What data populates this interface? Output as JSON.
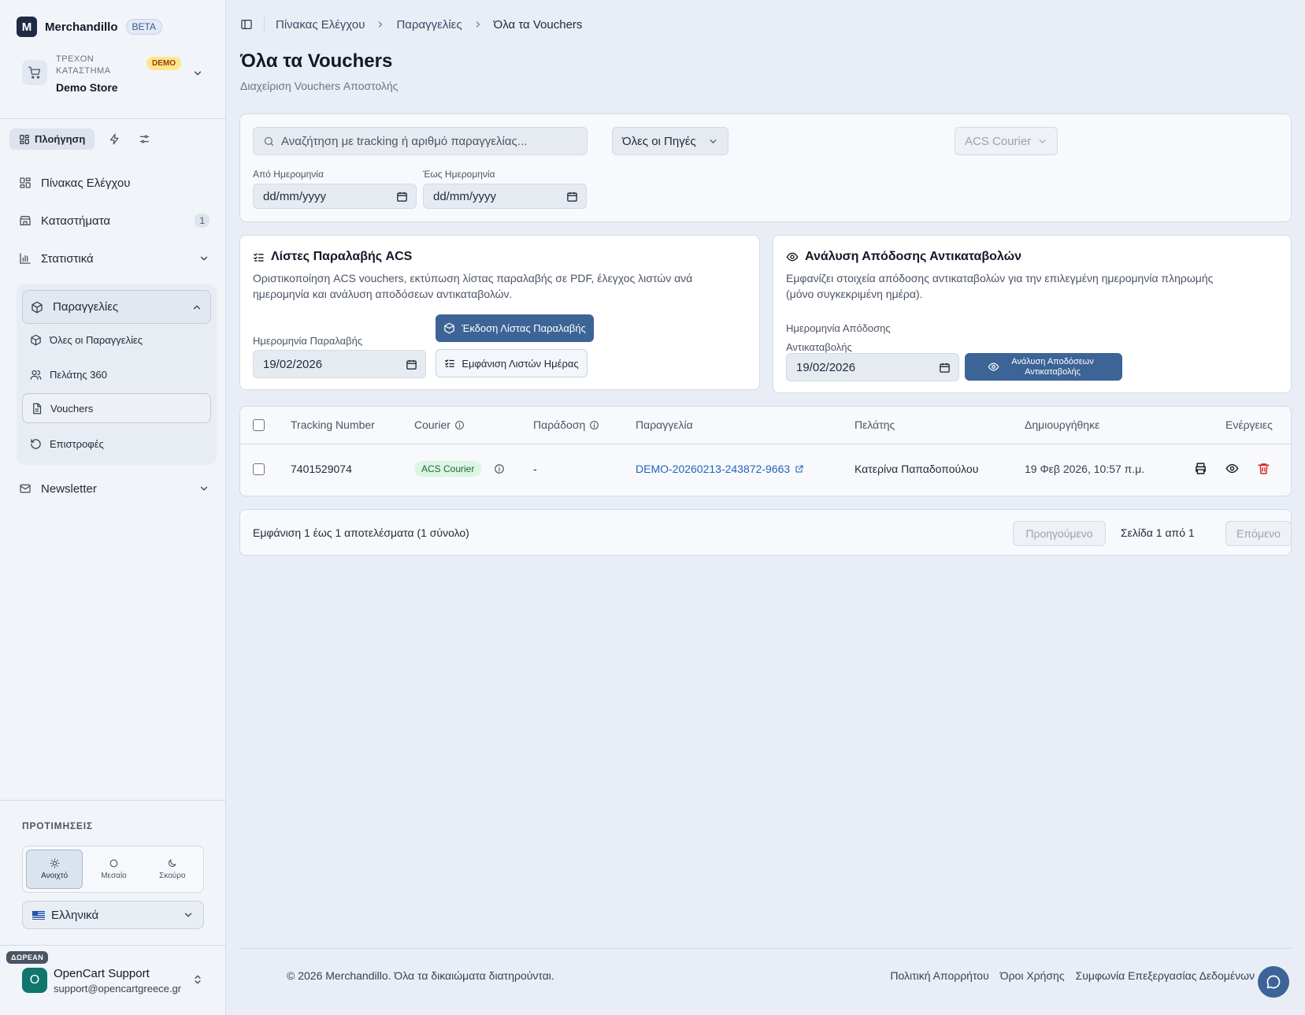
{
  "app": {
    "name": "Merchandillo",
    "badge": "BETA"
  },
  "store": {
    "caption": "ΤΡΕΧΟΝ ΚΑΤΑΣΤΗΜΑ",
    "name": "Demo Store",
    "badge": "DEMO"
  },
  "sidebar": {
    "tab_label": "Πλοήγηση",
    "items": [
      {
        "label": "Πίνακας Ελέγχου"
      },
      {
        "label": "Καταστήματα",
        "count": "1"
      },
      {
        "label": "Στατιστικά"
      }
    ],
    "orders_group": {
      "label": "Παραγγελίες",
      "children": [
        {
          "label": "Όλες οι Παραγγελίες"
        },
        {
          "label": "Πελάτης 360"
        },
        {
          "label": "Vouchers"
        },
        {
          "label": "Επιστροφές"
        }
      ]
    },
    "newsletter": {
      "label": "Newsletter"
    },
    "prefs_title": "ΠΡΟΤΙΜΗΣΕΙΣ",
    "themes": [
      {
        "label": "Ανοιχτό"
      },
      {
        "label": "Μεσαίο"
      },
      {
        "label": "Σκούρο"
      }
    ],
    "language": "Ελληνικά",
    "user": {
      "badge": "ΔΩΡΕΑΝ",
      "initial": "O",
      "name": "OpenCart Support",
      "email": "support@opencartgreece.gr"
    }
  },
  "breadcrumb": [
    "Πίνακας Ελέγχου",
    "Παραγγελίες",
    "Όλα τα Vouchers"
  ],
  "page": {
    "title": "Όλα τα Vouchers",
    "subtitle": "Διαχείριση Vouchers Αποστολής"
  },
  "filters": {
    "search_placeholder": "Αναζήτηση με tracking ή αριθμό παραγγελίας...",
    "source": "Όλες οι Πηγές",
    "courier": "ACS Courier",
    "from_label": "Από Ημερομηνία",
    "to_label": "Έως Ημερομηνία",
    "date_placeholder": "dd/mm/yyyy"
  },
  "acs_card": {
    "title": "Λίστες Παραλαβής ACS",
    "desc_line1": "Οριστικοποίηση ACS vouchers, εκτύπωση λίστας παραλαβής σε PDF, έλεγχος λιστών ανά",
    "desc_line2": "ημερομηνία και ανάλυση αποδόσεων αντικαταβολών.",
    "date_label": "Ημερομηνία Παραλαβής",
    "date_value": "19/02/2026",
    "issue_button": "Έκδοση Λίστας Παραλαβής",
    "show_button": "Εμφάνιση Λιστών Ημέρας"
  },
  "cod_card": {
    "title": "Ανάλυση Απόδοσης Αντικαταβολών",
    "desc_line1": "Εμφανίζει στοιχεία απόδοσης αντικαταβολών για την επιλεγμένη ημερομηνία πληρωμής",
    "desc_line2": "(μόνο συγκεκριμένη ημέρα).",
    "date_label_line1": "Ημερομηνία Απόδοσης",
    "date_label_line2": "Αντικαταβολής",
    "date_value": "19/02/2026",
    "button_line1": "Ανάλυση Αποδόσεων",
    "button_line2": "Αντικαταβολής"
  },
  "table": {
    "columns": [
      "Tracking Number",
      "Courier",
      "Παράδοση",
      "Παραγγελία",
      "Πελάτης",
      "Δημιουργήθηκε",
      "Ενέργειες"
    ],
    "rows": [
      {
        "tracking": "7401529074",
        "courier": "ACS Courier",
        "delivery": "-",
        "order": "DEMO-20260213-243872-9663",
        "customer": "Κατερίνα Παπαδοπούλου",
        "created": "19 Φεβ 2026, 10:57 π.μ."
      }
    ]
  },
  "pagination": {
    "summary": "Εμφάνιση 1 έως 1 αποτελέσματα (1 σύνολο)",
    "prev": "Προηγούμενο",
    "page": "Σελίδα 1 από 1",
    "next": "Επόμενο"
  },
  "footer": {
    "copyright": "© 2026 Merchandillo. Όλα τα δικαιώματα διατηρούνται.",
    "links": [
      "Πολιτική Απορρήτου",
      "Όροι Χρήσης",
      "Συμφωνία Επεξεργασίας Δεδομένων"
    ]
  },
  "colors": {
    "primary": "#3d6496",
    "delete": "#dc2626",
    "link": "#2563b8",
    "courier_badge": "#dcf5e4"
  }
}
